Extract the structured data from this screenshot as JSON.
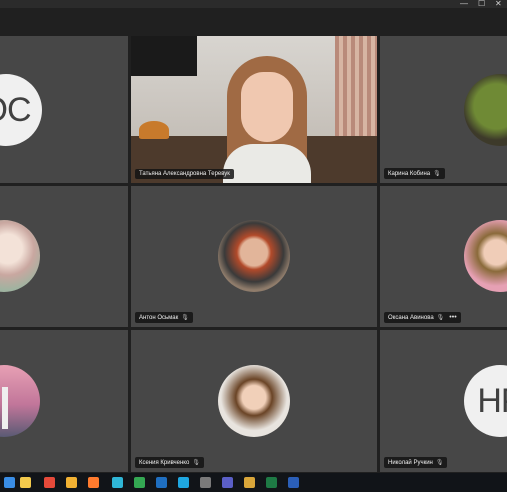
{
  "window": {
    "title": "",
    "controls": [
      "—",
      "☐",
      "✕"
    ]
  },
  "participants": [
    {
      "name": "",
      "initials": "ОС",
      "avatar": "initials"
    },
    {
      "name": "Татьяна Александровна Теревук",
      "video": true
    },
    {
      "name": "Карина Кобина",
      "avatar": "photo"
    },
    {
      "name": "",
      "avatar": "photo"
    },
    {
      "name": "Антон Осьмак",
      "avatar": "photo"
    },
    {
      "name": "Оксана Авинова",
      "avatar": "photo",
      "more": "•••"
    },
    {
      "name": "",
      "avatar": "photo"
    },
    {
      "name": "Ксения Кривченко",
      "avatar": "photo"
    },
    {
      "name": "Николай Ручкин",
      "initials": "НР",
      "avatar": "initials"
    }
  ],
  "mic_icon": "mic-off-icon",
  "taskbar": {
    "icons": [
      {
        "name": "start-icon",
        "color": "#3a8ee6"
      },
      {
        "name": "file-explorer-icon",
        "color": "#f2c94c"
      },
      {
        "name": "store-icon",
        "color": "#e64a3a"
      },
      {
        "name": "folder-icon",
        "color": "#f2b233"
      },
      {
        "name": "firefox-icon",
        "color": "#ff7b2e"
      },
      {
        "name": "edge-icon",
        "color": "#2fb6d6"
      },
      {
        "name": "chrome-icon",
        "color": "#34a853"
      },
      {
        "name": "outlook-icon",
        "color": "#1f6fc1"
      },
      {
        "name": "skype-icon",
        "color": "#1ea7e1"
      },
      {
        "name": "calculator-icon",
        "color": "#7a7a7a"
      },
      {
        "name": "teams-icon",
        "color": "#5b5fc7"
      },
      {
        "name": "app-icon",
        "color": "#d9a63a"
      },
      {
        "name": "excel-icon",
        "color": "#1e7a45"
      },
      {
        "name": "word-icon",
        "color": "#2b5fb8"
      }
    ]
  }
}
